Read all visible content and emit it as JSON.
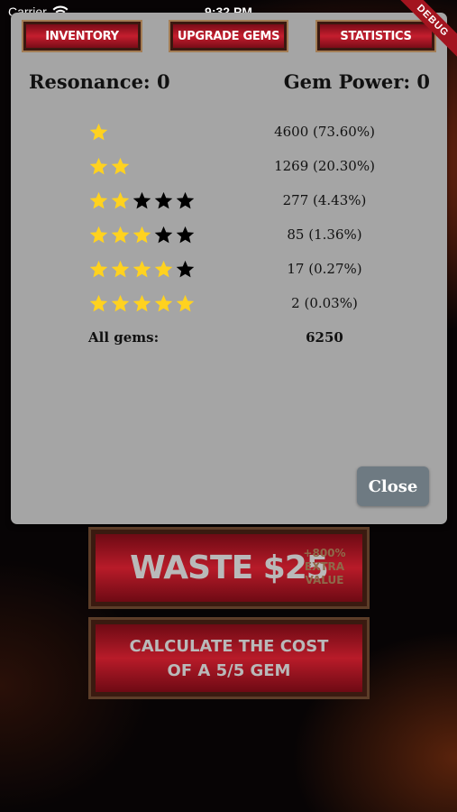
{
  "status_bar": {
    "carrier": "Carrier",
    "time": "9:32 PM",
    "debug_banner": "DEBUG"
  },
  "tabs": [
    {
      "label": "INVENTORY"
    },
    {
      "label": "UPGRADE GEMS"
    },
    {
      "label": "STATISTICS"
    }
  ],
  "summary": {
    "resonance": "Resonance: 0",
    "gem_power": "Gem Power: 0"
  },
  "star_colors": {
    "filled": "#ffd21f",
    "empty": "#000000"
  },
  "stats": [
    {
      "stars": 1,
      "max_stars": 1,
      "count": "4600 (73.60%)"
    },
    {
      "stars": 2,
      "max_stars": 2,
      "count": "1269 (20.30%)"
    },
    {
      "stars": 2,
      "max_stars": 5,
      "count": "277 (4.43%)"
    },
    {
      "stars": 3,
      "max_stars": 5,
      "count": "85 (1.36%)"
    },
    {
      "stars": 4,
      "max_stars": 5,
      "count": "17 (0.27%)"
    },
    {
      "stars": 5,
      "max_stars": 5,
      "count": "2 (0.03%)"
    }
  ],
  "all_gems": {
    "label": "All gems:",
    "value": "6250"
  },
  "close_label": "Close",
  "waste_button": {
    "label": "WASTE $25",
    "extra": "+800% EXTRA VALUE"
  },
  "calc_button": {
    "label": "CALCULATE THE COST OF A 5/5 GEM"
  }
}
